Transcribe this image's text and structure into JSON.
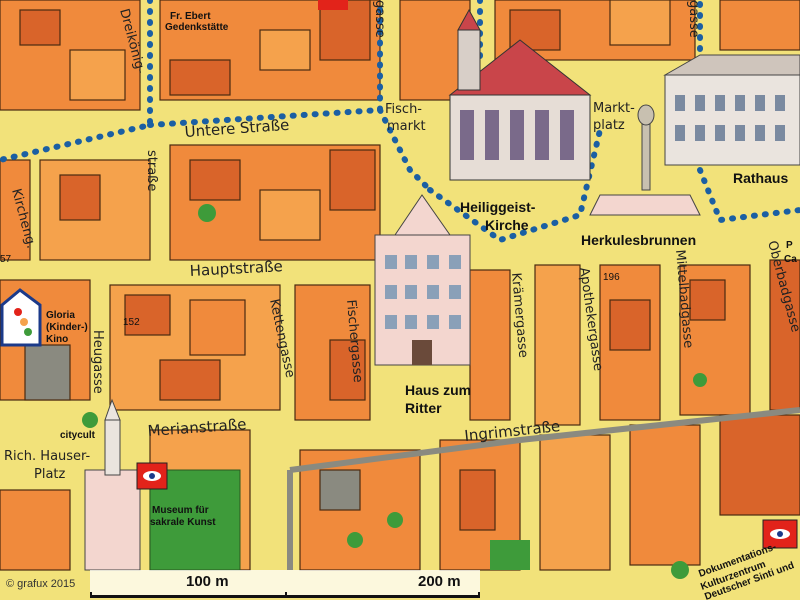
{
  "map": {
    "copyright": "© grafux 2015",
    "scale": {
      "label_1": "100 m",
      "label_2": "200 m"
    },
    "streets": {
      "untere_strasse": "Untere Straße",
      "hauptstrasse": "Hauptstraße",
      "merianstrasse": "Merianstraße",
      "ingrimstrasse": "Ingrimstraße",
      "dreikoenig": "Dreikönig-",
      "strasse_suffix": "straße",
      "kirchengasse": "Kircheng.",
      "heugasse": "Heugasse",
      "kettengasse": "Kettengasse",
      "fischmarkt_1": "Fisch-",
      "fischmarkt_2": "markt",
      "marktplatz_1": "Markt-",
      "marktplatz_2": "platz",
      "kraemergasse": "Krämergasse",
      "apothekergasse": "Apothekergasse",
      "mittelbadgasse": "Mittelbadgasse",
      "oberbadgasse": "Oberbadgasse",
      "fischergasse": "Fischergasse",
      "gasse_top": "gasse",
      "gasse_top2": "gasse",
      "rich_hauser_1": "Rich. Hauser-",
      "rich_hauser_2": "Platz"
    },
    "pois": {
      "ebert_1": "Fr. Ebert",
      "ebert_2": "Gedenkstätte",
      "heiliggeist_1": "Heiliggeist-",
      "heiliggeist_2": "Kirche",
      "herkules": "Herkulesbrunnen",
      "rathaus": "Rathaus",
      "haus_ritter_1": "Haus zum",
      "haus_ritter_2": "Ritter",
      "gloria_1": "Gloria",
      "gloria_2": "(Kinder-)",
      "gloria_3": "Kino",
      "museum_1": "Museum für",
      "museum_2": "sakrale Kunst",
      "citycult": "citycult",
      "doku_1": "Dokumentations-",
      "doku_2": "Kulturzentrum",
      "doku_3": "Deutscher Sinti und",
      "pc_1": "P",
      "pc_2": "Ca"
    },
    "house_numbers": {
      "n57": "57",
      "n152": "152",
      "n196": "196"
    },
    "colors": {
      "street": "#f2e27a",
      "block_orange": "#f08a3c",
      "block_dark": "#d9642a",
      "block_light": "#f5a24c",
      "path_dots": "#1b5fa3",
      "green": "#3e9b3a",
      "wall_gray": "#8a8a80",
      "marker_red": "#e2231a"
    }
  }
}
